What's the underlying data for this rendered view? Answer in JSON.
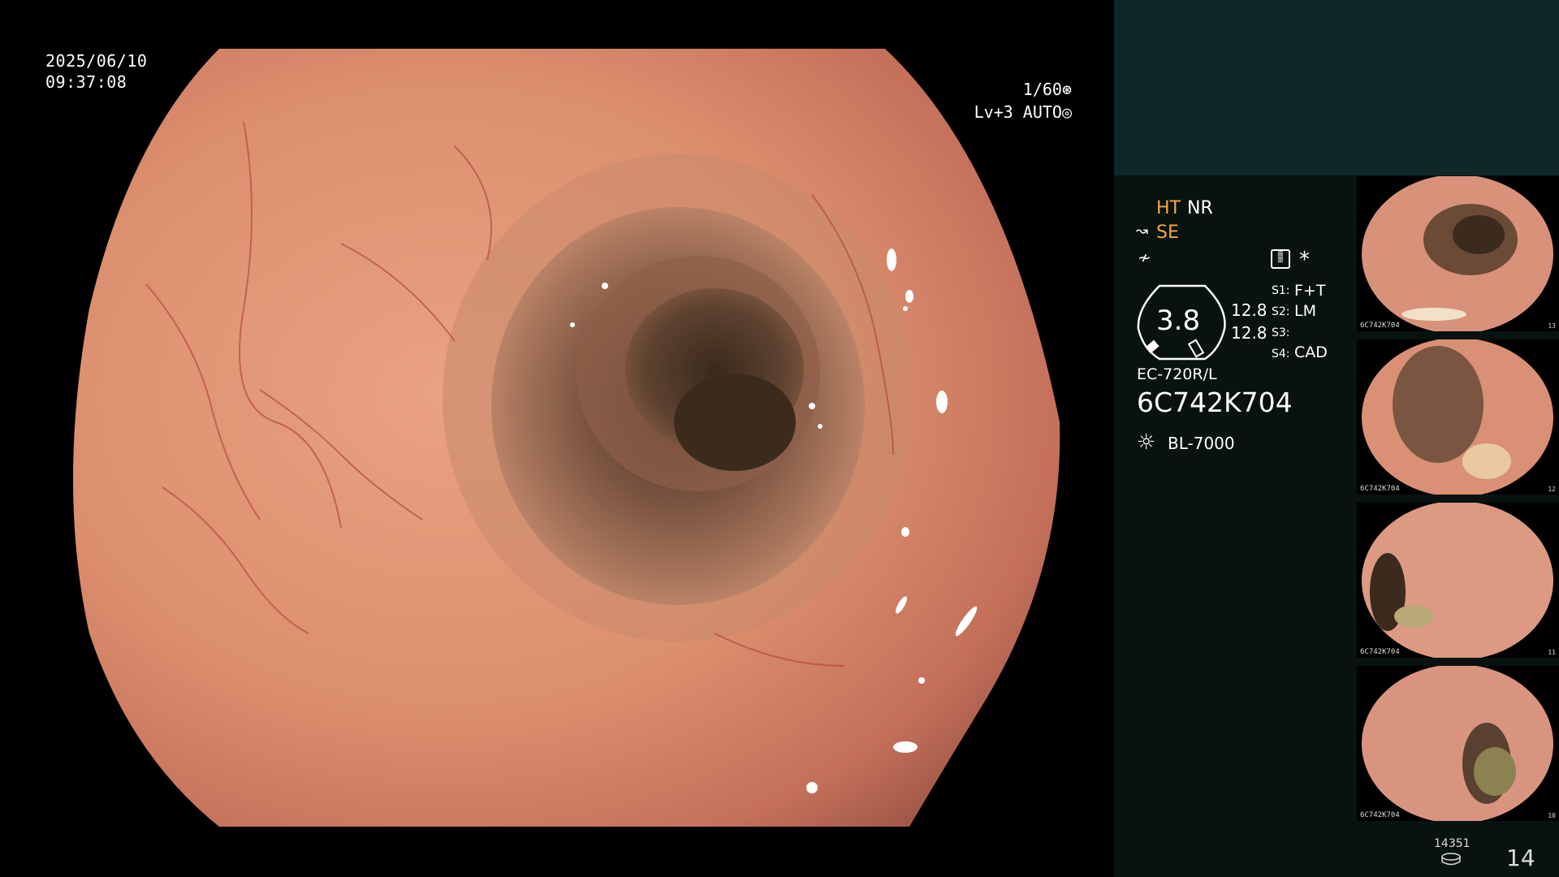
{
  "overlay": {
    "date": "2025/06/10",
    "time": "09:37:08",
    "shutter": "1/60",
    "level": "Lv+3",
    "mode": "AUTO"
  },
  "panel": {
    "ht": "HT",
    "nr": "NR",
    "se": "SE",
    "gauge_value": "3.8",
    "gauge_top": "12.8",
    "gauge_bottom": "12.8",
    "s1_key": "S1:",
    "s1_val": "F+T",
    "s2_key": "S2:",
    "s2_val": "LM",
    "s3_key": "S3:",
    "s3_val": "",
    "s4_key": "S4:",
    "s4_val": "CAD",
    "scope_model": "EC-720R/L",
    "scope_serial": "6C742K704",
    "light_source": "BL-7000",
    "asterisk": "*"
  },
  "thumbnails": [
    {
      "label": "6C742K704",
      "num": "13"
    },
    {
      "label": "6C742K704",
      "num": "12"
    },
    {
      "label": "6C742K704",
      "num": "11"
    },
    {
      "label": "6C742K704",
      "num": "10"
    }
  ],
  "footer": {
    "storage_count": "14351",
    "page_num": "14"
  },
  "colors": {
    "panel_bg": "#081210",
    "panel_header_bg": "#0d2827",
    "accent_orange": "#f3a745",
    "mucosa": "#d98a6c"
  }
}
